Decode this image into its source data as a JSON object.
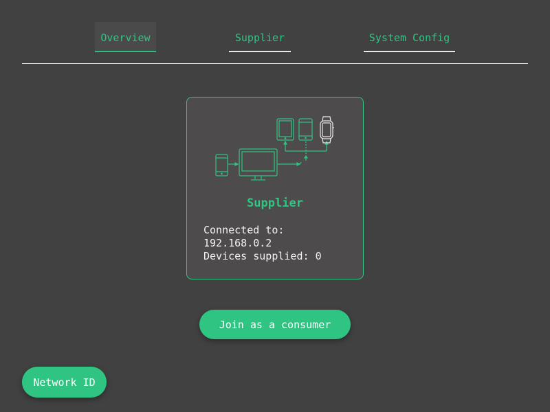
{
  "tabs": [
    {
      "label": "Overview",
      "active": true
    },
    {
      "label": "Supplier",
      "active": false
    },
    {
      "label": "System Config",
      "active": false
    }
  ],
  "card": {
    "title": "Supplier",
    "connected_label": "Connected to:",
    "ip": "192.168.0.2",
    "devices_label": "Devices supplied:",
    "devices_count": "0",
    "illustration_icons": [
      "phone-icon",
      "monitor-icon",
      "tablet-icon",
      "phone-icon",
      "smartwatch-icon"
    ]
  },
  "buttons": {
    "join": "Join as a consumer",
    "network_id": "Network ID"
  },
  "colors": {
    "background": "#414142",
    "accent": "#2fc482",
    "card_bg": "#4e4b4c",
    "divider": "#dcdcdc",
    "text": "#f2f2f2"
  }
}
